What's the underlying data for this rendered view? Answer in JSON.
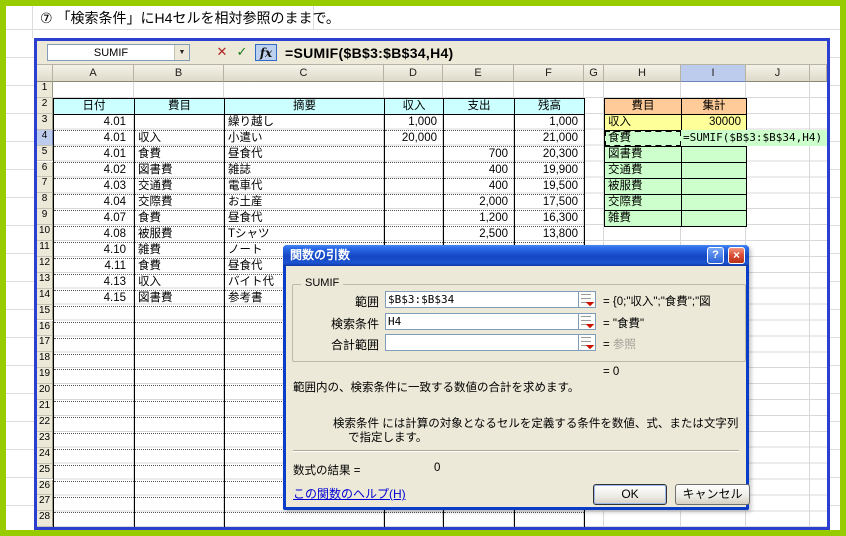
{
  "annotation": {
    "marker": "⑦",
    "text": "「検索条件」にH4セルを相対参照のままで。"
  },
  "formula_bar": {
    "name_box": "SUMIF",
    "dropdown_glyph": "▼",
    "cancel_glyph": "✕",
    "enter_glyph": "✓",
    "fx_label": "fx",
    "formula": "=SUMIF($B$3:$B$34,H4)"
  },
  "sheet": {
    "col_headers": [
      "A",
      "B",
      "C",
      "D",
      "E",
      "F",
      "G",
      "H",
      "I",
      "J"
    ],
    "row_headers": [
      "1",
      "2",
      "3",
      "4",
      "5",
      "6",
      "7",
      "8",
      "9",
      "10",
      "11",
      "12",
      "13",
      "14",
      "15",
      "16",
      "17",
      "18",
      "19",
      "20",
      "21",
      "22",
      "23",
      "24",
      "25",
      "26",
      "27",
      "28"
    ],
    "selected_col": "I",
    "selected_row": "4",
    "table": {
      "headers": [
        "日付",
        "費目",
        "摘要",
        "収入",
        "支出",
        "残高"
      ],
      "rows": [
        [
          "4.01",
          "",
          "繰り越し",
          "1,000",
          "",
          "1,000"
        ],
        [
          "4.01",
          "収入",
          "小遣い",
          "20,000",
          "",
          "21,000"
        ],
        [
          "4.01",
          "食費",
          "昼食代",
          "",
          "700",
          "20,300"
        ],
        [
          "4.02",
          "図書費",
          "雑誌",
          "",
          "400",
          "19,900"
        ],
        [
          "4.03",
          "交通費",
          "電車代",
          "",
          "400",
          "19,500"
        ],
        [
          "4.04",
          "交際費",
          "お土産",
          "",
          "2,000",
          "17,500"
        ],
        [
          "4.07",
          "食費",
          "昼食代",
          "",
          "1,200",
          "16,300"
        ],
        [
          "4.08",
          "被服費",
          "Tシャツ",
          "",
          "2,500",
          "13,800"
        ],
        [
          "4.10",
          "雑費",
          "ノート",
          "",
          "",
          ""
        ],
        [
          "4.11",
          "食費",
          "昼食代",
          "",
          "",
          ""
        ],
        [
          "4.13",
          "収入",
          "バイト代",
          "",
          "",
          ""
        ],
        [
          "4.15",
          "図書費",
          "参考書",
          "",
          "",
          ""
        ]
      ]
    },
    "summary": {
      "headers": [
        "費目",
        "集計"
      ],
      "rows": [
        [
          "収入",
          "30000"
        ],
        [
          "食費",
          ""
        ],
        [
          "図書費",
          ""
        ],
        [
          "交通費",
          ""
        ],
        [
          "被服費",
          ""
        ],
        [
          "交際費",
          ""
        ],
        [
          "雑費",
          ""
        ]
      ],
      "edit_formula": "=SUMIF($B$3:$B$34,H4)"
    },
    "colors": {
      "table_header_cyan": "#CCFFFF",
      "summary_header_orange": "#FFCC99",
      "summary_income_yellow": "#FFFF99",
      "summary_green": "#CCFFCC",
      "selection_blue": "#BDCBEC",
      "window_border_blue": "#2B3FD0",
      "frame_green": "#99CC00"
    }
  },
  "dialog": {
    "title": "関数の引数",
    "help_glyph": "?",
    "close_glyph": "×",
    "group_label": "SUMIF",
    "fields": [
      {
        "label": "範囲",
        "value": "$B$3:$B$34",
        "eq": "=",
        "result": "{0;\"収入\";\"食費\";\"図"
      },
      {
        "label": "検索条件",
        "value": "H4",
        "eq": "=",
        "result": "\"食費\""
      },
      {
        "label": "合計範囲",
        "value": "",
        "eq": "=",
        "result": "参照"
      }
    ],
    "current_eq": "=  0",
    "description": "範囲内の、検索条件に一致する数値の合計を求めます。",
    "arg_help": "検索条件 には計算の対象となるセルを定義する条件を数値、式、または文字列で指定します。",
    "formula_result_label": "数式の結果 =",
    "formula_result_value": "0",
    "help_link": "この関数のヘルプ(H)",
    "ok_label": "OK",
    "cancel_label": "キャンセル"
  }
}
